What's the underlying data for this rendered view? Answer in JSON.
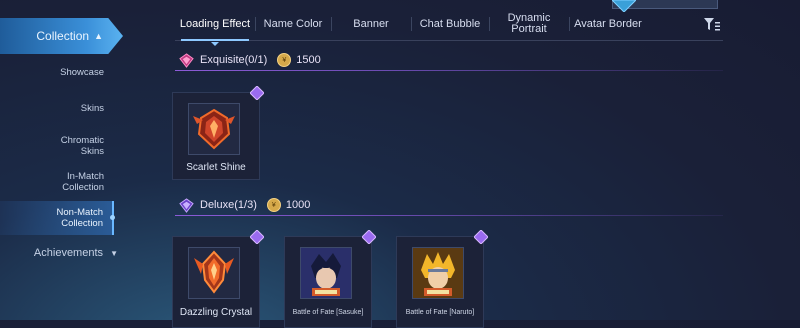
{
  "sidebar": {
    "collection_label": "Collection",
    "items": [
      {
        "label": "Showcase"
      },
      {
        "label": "Skins"
      },
      {
        "label": "Chromatic Skins",
        "line1": "Chromatic",
        "line2": "Skins"
      },
      {
        "label": "In-Match Collection",
        "line1": "In-Match",
        "line2": "Collection"
      },
      {
        "label": "Non-Match Collection",
        "line1": "Non-Match",
        "line2": "Collection",
        "active": true
      }
    ],
    "achievements_label": "Achievements"
  },
  "tabs": [
    {
      "label": "Loading Effect",
      "active": true
    },
    {
      "label": "Name Color"
    },
    {
      "label": "Banner"
    },
    {
      "label": "Chat Bubble"
    },
    {
      "label": "Dynamic Portrait",
      "line1": "Dynamic",
      "line2": "Portrait"
    },
    {
      "label": "Avatar Border"
    }
  ],
  "sections": [
    {
      "title": "Exquisite(0/1)",
      "cost": "1500",
      "gem_color": "#e0569a",
      "items": [
        {
          "name": "Scarlet Shine",
          "icon": "scarlet-shine-emblem"
        }
      ]
    },
    {
      "title": "Deluxe(1/3)",
      "cost": "1000",
      "gem_color": "#9a6bf0",
      "items": [
        {
          "name": "Dazzling Crystal",
          "icon": "dazzling-crystal-emblem"
        },
        {
          "name": "Battle of Fate [Sasuke]",
          "icon": "sasuke-portrait"
        },
        {
          "name": "Battle of Fate [Naruto]",
          "icon": "naruto-portrait"
        }
      ]
    }
  ],
  "colors": {
    "accent": "#3a8fd8",
    "section_bar": "#8c5bd8",
    "coin": "#d6a94a"
  },
  "icons": {
    "filter": "filter-icon",
    "collapse": "chevron-up-icon",
    "expand": "chevron-down-icon",
    "currency": "coin-icon"
  }
}
